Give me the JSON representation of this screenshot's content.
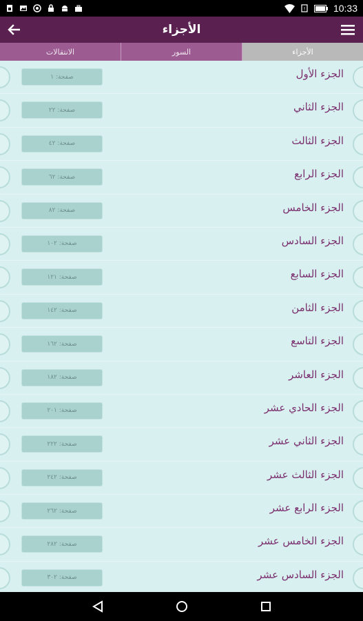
{
  "status_bar": {
    "time": "10:33",
    "icons": [
      "sim-icon",
      "image-icon",
      "sync-icon",
      "lock-icon",
      "android-icon",
      "briefcase-icon",
      "wifi-icon",
      "no-sim-icon",
      "battery-icon"
    ]
  },
  "toolbar": {
    "title": "الأجزاء",
    "back_icon": "arrow-left-icon",
    "menu_icon": "hamburger-menu-icon"
  },
  "tabs": [
    {
      "label": "الانتقالات",
      "active": false
    },
    {
      "label": "السور",
      "active": false
    },
    {
      "label": "الأجزاء",
      "active": true
    }
  ],
  "colors": {
    "toolbar": "#5a2050",
    "tab": "#9c5c92",
    "tab_active": "#b9b9b9",
    "list_bg": "#d8f0ef",
    "pill": "#a9d2cf",
    "item_text": "#7a2e6e"
  },
  "items": [
    {
      "name": "الجزء الأول",
      "page": "صفحة: ١"
    },
    {
      "name": "الجزء الثاني",
      "page": "صفحة: ٢٢"
    },
    {
      "name": "الجزء الثالث",
      "page": "صفحة: ٤٢"
    },
    {
      "name": "الجزء الرابع",
      "page": "صفحة: ٦٢"
    },
    {
      "name": "الجزء الخامس",
      "page": "صفحة: ٨٢"
    },
    {
      "name": "الجزء السادس",
      "page": "صفحة: ١٠٢"
    },
    {
      "name": "الجزء السابع",
      "page": "صفحة: ١٢١"
    },
    {
      "name": "الجزء الثامن",
      "page": "صفحة: ١٤٢"
    },
    {
      "name": "الجزء التاسع",
      "page": "صفحة: ١٦٢"
    },
    {
      "name": "الجزء العاشر",
      "page": "صفحة: ١٨٢"
    },
    {
      "name": "الجزء الحادي عشر",
      "page": "صفحة: ٢٠١"
    },
    {
      "name": "الجزء الثاني عشر",
      "page": "صفحة: ٢٢٢"
    },
    {
      "name": "الجزء الثالث عشر",
      "page": "صفحة: ٢٤٢"
    },
    {
      "name": "الجزء الرابع عشر",
      "page": "صفحة: ٢٦٢"
    },
    {
      "name": "الجزء الخامس عشر",
      "page": "صفحة: ٢٨٢"
    },
    {
      "name": "الجزء السادس عشر",
      "page": "صفحة: ٣٠٢"
    }
  ],
  "nav": {
    "back_icon": "nav-back-icon",
    "home_icon": "nav-home-icon",
    "recents_icon": "nav-recents-icon"
  }
}
